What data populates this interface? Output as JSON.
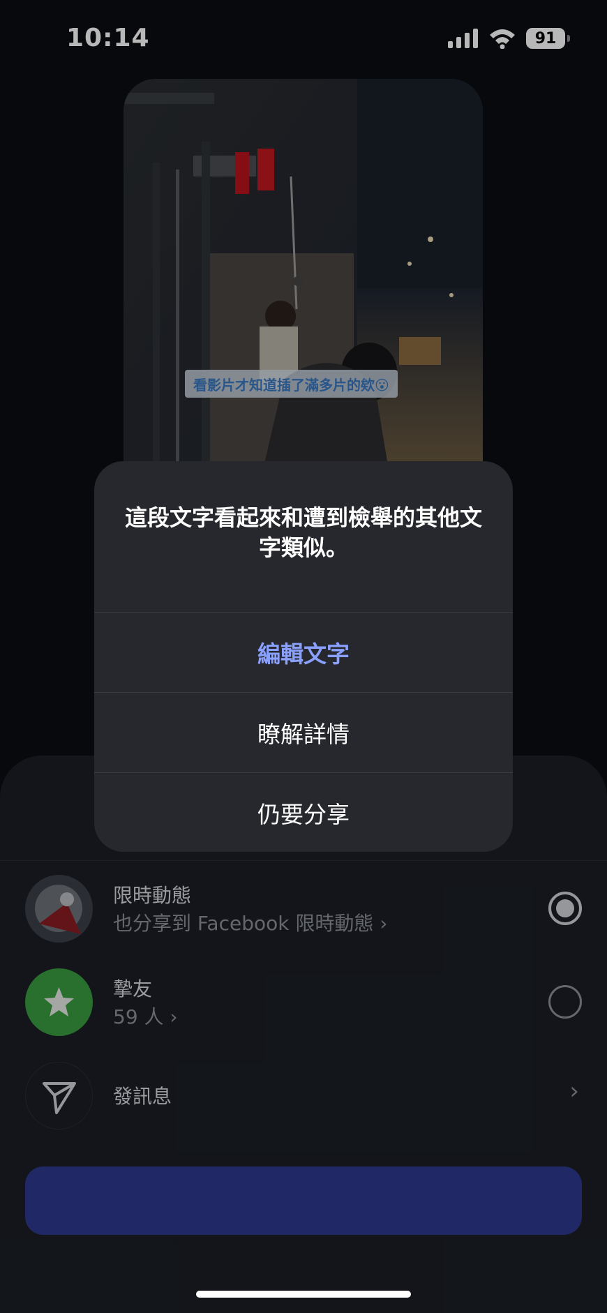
{
  "status_bar": {
    "time": "10:14",
    "battery": "91"
  },
  "preview": {
    "overlay_text": "看影片才知道插了滿多片的欸😮"
  },
  "share_options": [
    {
      "title": "限時動態",
      "subtitle": "也分享到 Facebook 限時動態 ›",
      "selected": true
    },
    {
      "title": "摯友",
      "subtitle": "59 人 ›",
      "selected": false
    },
    {
      "title": "發訊息",
      "chevron": "›"
    }
  ],
  "alert": {
    "message": "這段文字看起來和遭到檢舉的其他文字類似。",
    "actions": [
      "編輯文字",
      "瞭解詳情",
      "仍要分享"
    ]
  },
  "colors": {
    "accent": "#8aa0ff",
    "button": "#2d3a8c",
    "close_friends_green": "#3a9a3f"
  },
  "icons": [
    "signal-icon",
    "wifi-icon",
    "battery-icon",
    "star-icon",
    "send-icon",
    "chevron-right-icon"
  ]
}
